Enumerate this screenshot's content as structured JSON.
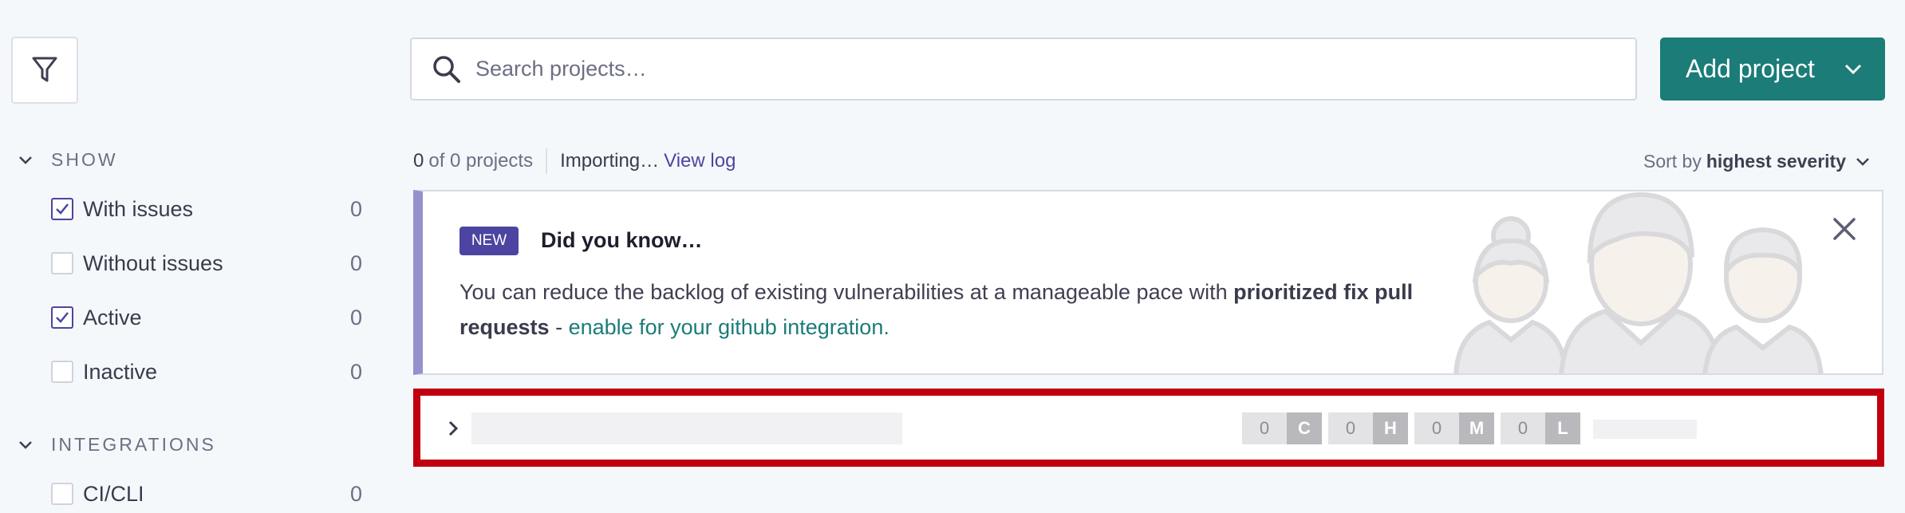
{
  "sidebar": {
    "filter_icon": "filter-funnel-icon",
    "show": {
      "title": "SHOW",
      "items": [
        {
          "label": "With issues",
          "count": "0",
          "checked": true
        },
        {
          "label": "Without issues",
          "count": "0",
          "checked": false
        },
        {
          "label": "Active",
          "count": "0",
          "checked": true
        },
        {
          "label": "Inactive",
          "count": "0",
          "checked": false
        }
      ]
    },
    "integrations": {
      "title": "INTEGRATIONS",
      "items": [
        {
          "label": "CI/CLI",
          "count": "0",
          "checked": false
        }
      ]
    }
  },
  "search": {
    "placeholder": "Search projects…",
    "value": ""
  },
  "add_project": {
    "label": "Add project"
  },
  "meta": {
    "count_num": "0",
    "count_rest": "of 0 projects",
    "importing": "Importing…",
    "view_log": "View log"
  },
  "sort": {
    "prefix": "Sort by",
    "value": "highest severity"
  },
  "info_card": {
    "badge": "NEW",
    "title": "Did you know…",
    "body_prefix": "You can reduce the backlog of existing vulnerabilities at a manageable pace with",
    "body_bold": "prioritized fix pull requests",
    "body_dash": " - ",
    "link": "enable for your github integration."
  },
  "project_row": {
    "severities": [
      {
        "count": "0",
        "letter": "C"
      },
      {
        "count": "0",
        "letter": "H"
      },
      {
        "count": "0",
        "letter": "M"
      },
      {
        "count": "0",
        "letter": "L"
      }
    ]
  },
  "colors": {
    "accent": "#1b7c78",
    "brand": "#4b45a1",
    "highlight": "#c1000f",
    "card_border": "#9591cf"
  }
}
